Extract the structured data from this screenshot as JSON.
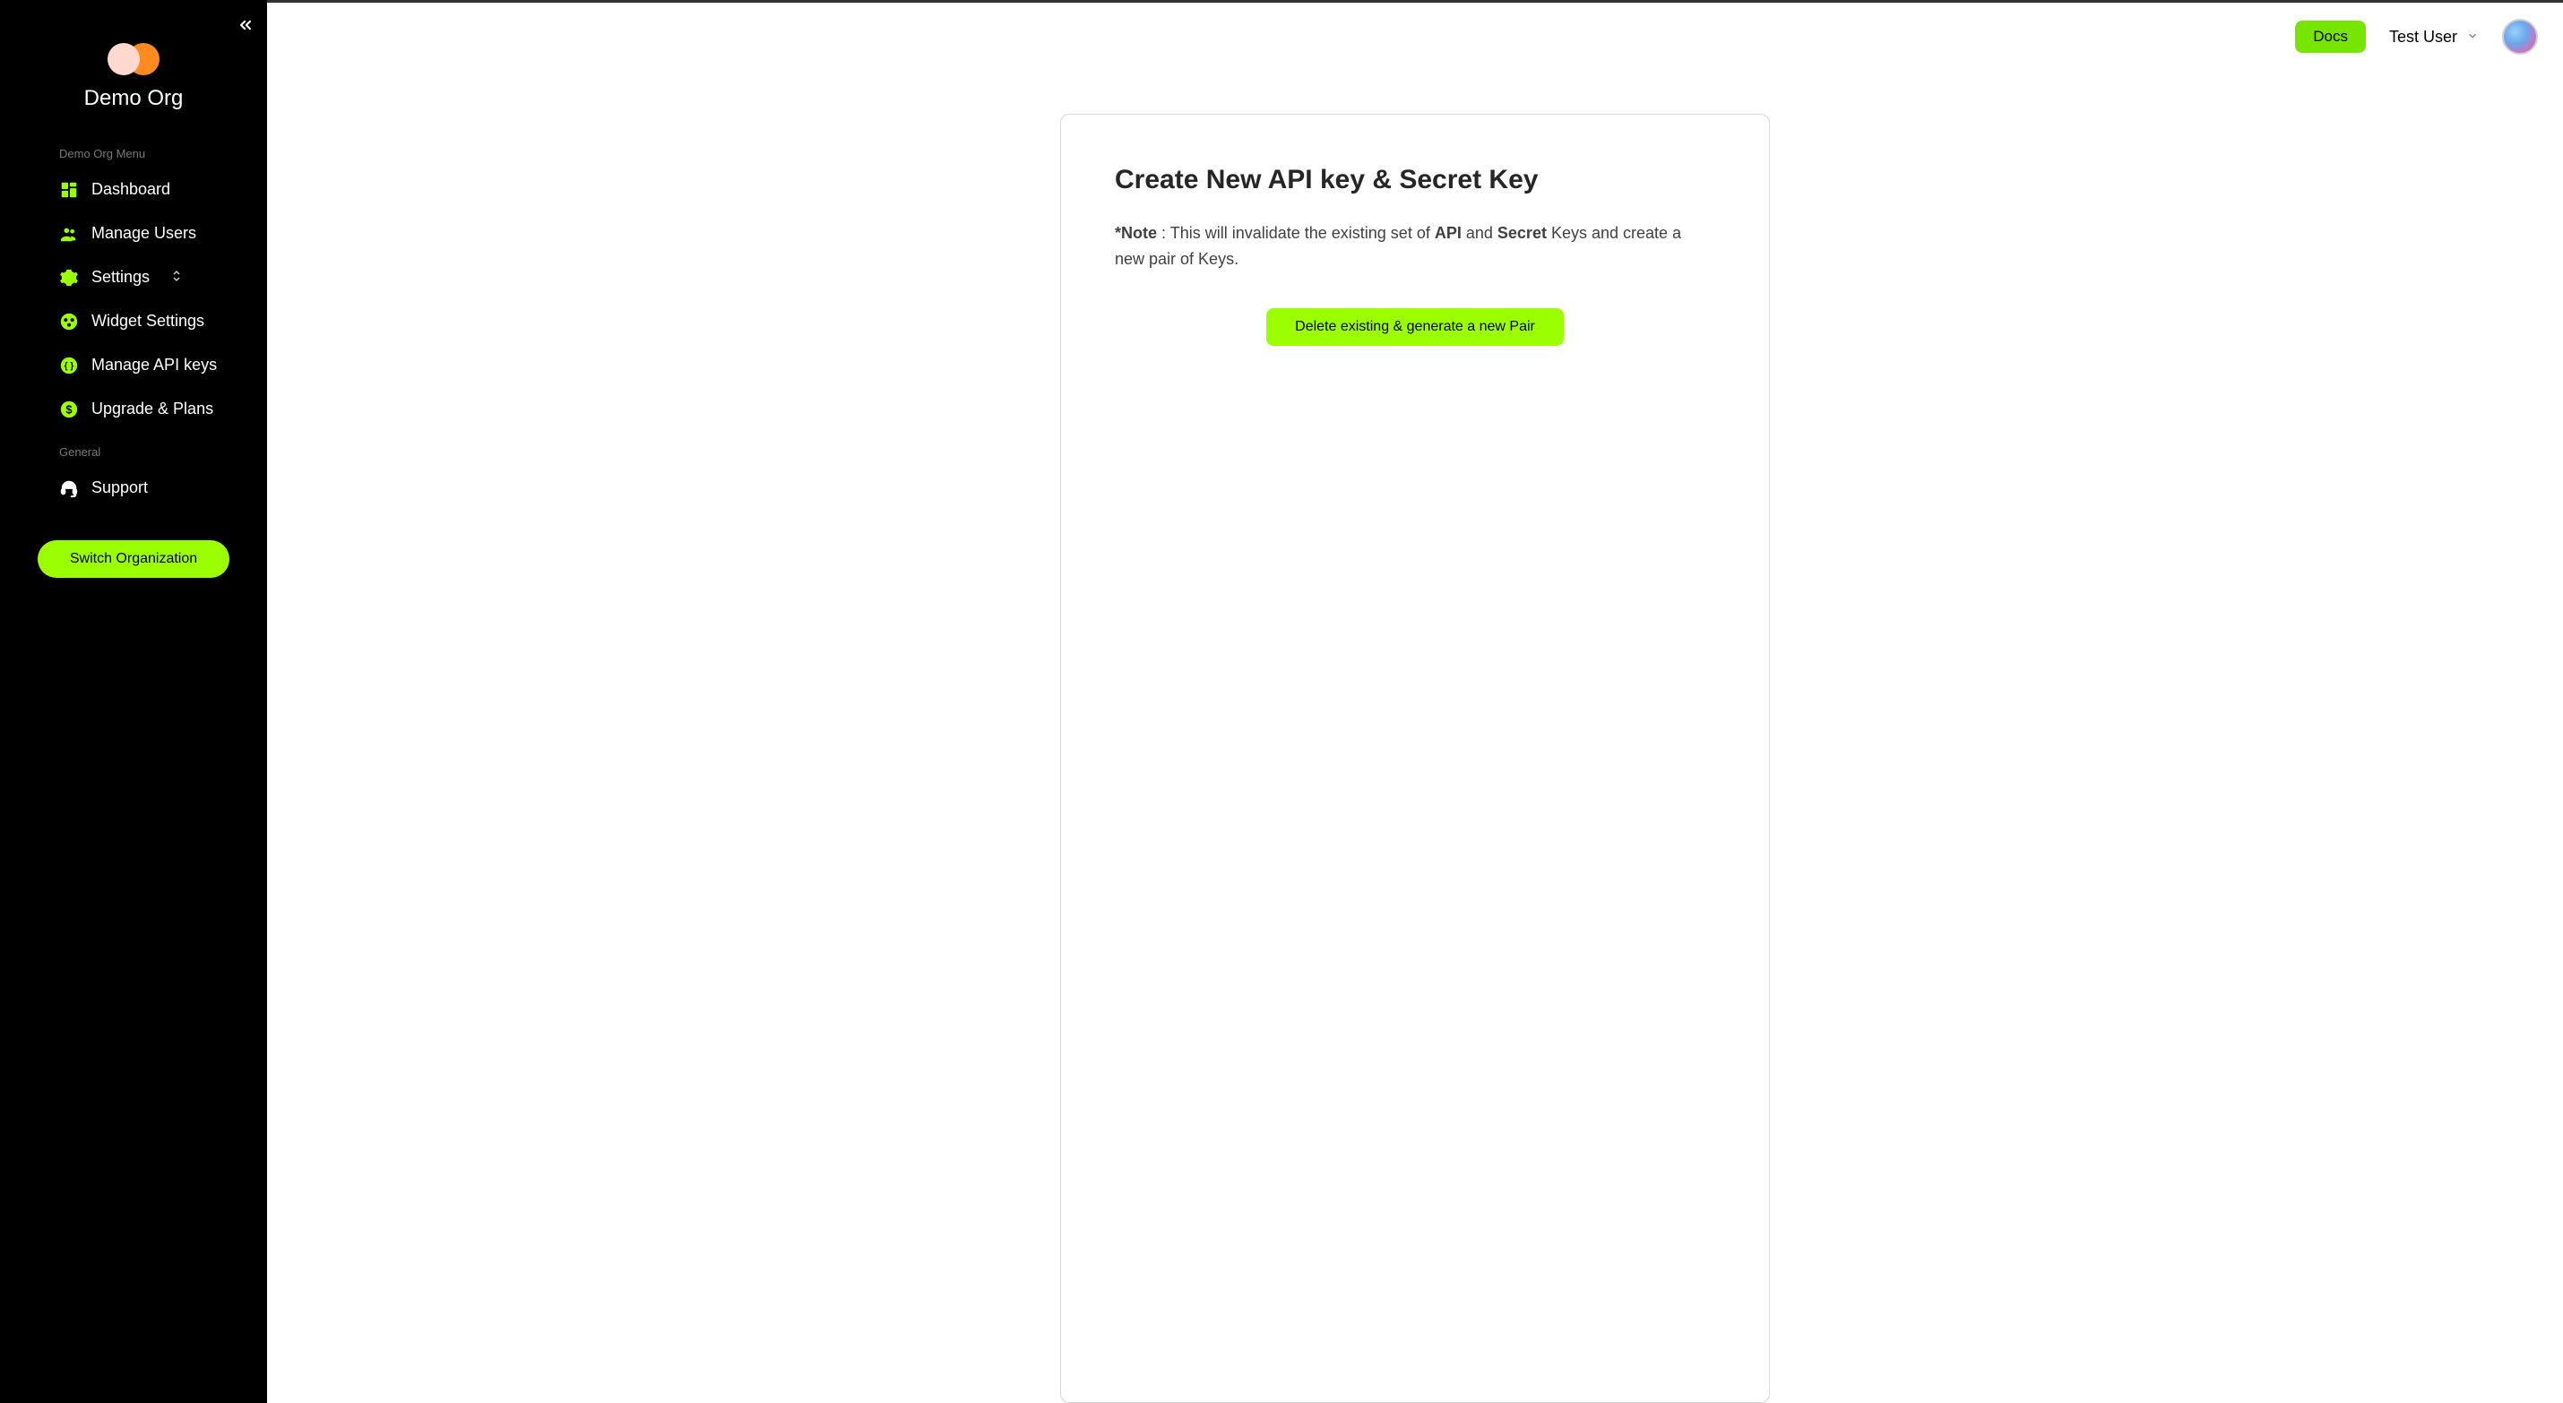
{
  "sidebar": {
    "org_name": "Demo Org",
    "section_menu_label": "Demo Org Menu",
    "section_general_label": "General",
    "items": {
      "dashboard": "Dashboard",
      "manage_users": "Manage Users",
      "settings": "Settings",
      "widget_settings": "Widget Settings",
      "manage_api_keys": "Manage API keys",
      "upgrade_plans": "Upgrade & Plans",
      "support": "Support"
    },
    "switch_btn": "Switch Organization"
  },
  "topbar": {
    "docs_btn": "Docs",
    "user_name": "Test User"
  },
  "card": {
    "title": "Create New API key & Secret Key",
    "note_prefix_bold": "*Note",
    "note_mid1": " : This will invalidate the existing set of ",
    "note_api": "API",
    "note_mid2": " and ",
    "note_secret": "Secret",
    "note_suffix": " Keys and create a new pair of Keys.",
    "button": "Delete existing & generate a new Pair"
  }
}
